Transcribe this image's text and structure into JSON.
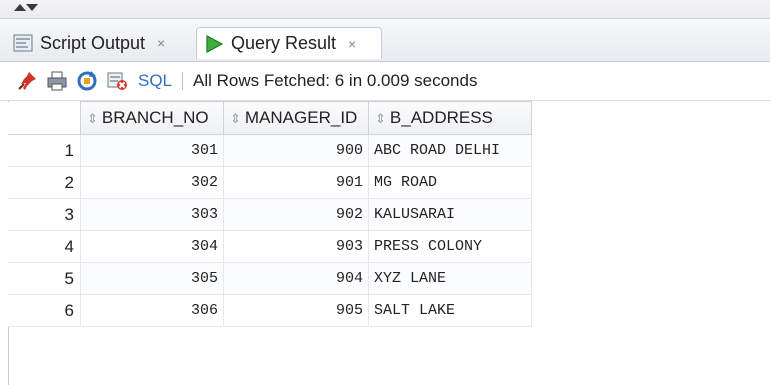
{
  "tabs": [
    {
      "label": "Script Output",
      "close": "×",
      "icon": "script-output-icon"
    },
    {
      "label": "Query Result",
      "close": "×",
      "icon": "run-arrow-icon"
    }
  ],
  "toolbar": {
    "icons": [
      "pin-icon",
      "print-icon",
      "refresh-sql-icon",
      "cancel-query-icon"
    ],
    "sql_label": "SQL",
    "status": "All Rows Fetched: 6 in 0.009 seconds"
  },
  "grid": {
    "columns": [
      "BRANCH_NO",
      "MANAGER_ID",
      "B_ADDRESS"
    ],
    "rows": [
      {
        "n": "1",
        "branch_no": "301",
        "manager_id": "900",
        "address": "ABC ROAD DELHI"
      },
      {
        "n": "2",
        "branch_no": "302",
        "manager_id": "901",
        "address": "MG ROAD"
      },
      {
        "n": "3",
        "branch_no": "303",
        "manager_id": "902",
        "address": "KALUSARAI"
      },
      {
        "n": "4",
        "branch_no": "304",
        "manager_id": "903",
        "address": "PRESS COLONY"
      },
      {
        "n": "5",
        "branch_no": "305",
        "manager_id": "904",
        "address": "XYZ LANE"
      },
      {
        "n": "6",
        "branch_no": "306",
        "manager_id": "905",
        "address": "SALT LAKE"
      }
    ]
  },
  "colors": {
    "accent_green": "#2e9e2e",
    "link_blue": "#2f6fbf"
  }
}
